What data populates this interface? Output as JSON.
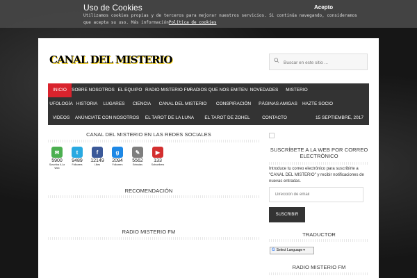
{
  "cookie_bar": {
    "title": "Uso de Cookies",
    "text": "Utilizamos cookies propias y de terceros para mejorar nuestros servicios. Si continúa navegando, consideramos que acepta su uso. Más información",
    "link": "Política de cookies",
    "accept": "Acepto"
  },
  "site": {
    "logo_text": "CANAL DEL MISTERIO",
    "search_placeholder": "Buscar en este sitio ..."
  },
  "nav": {
    "rows": [
      [
        "INICIO",
        "SOBRE NOSOTROS",
        "EL EQUIPO",
        "RADIO MISTERIO FM",
        "RADIOS QUE NOS EMITEN",
        "NOVEDADES",
        "MISTERIO"
      ],
      [
        "UFOLOGÍA",
        "HISTORIA",
        "LUGARES",
        "CIENCIA",
        "CANAL DEL MISTERIO",
        "CONSPIRACIÓN",
        "PÁGINAS AMIGAS",
        "HAZTE SOCIO"
      ],
      [
        "VIDEOS",
        "ANÚNCIATE CON NOSOTROS",
        "EL TAROT DE LA LUNA",
        "EL TAROT DE ZOHEL",
        "CONTACTO"
      ]
    ],
    "date": "15 SEPTIEMBRE, 2017"
  },
  "main": {
    "social_title": "CANAL DEL MISTERIO EN LAS REDES SOCIALES",
    "social": [
      {
        "count": "5900",
        "label": "Suscritos A La Web",
        "icon": "subscribers-icon",
        "color": "#4caf50"
      },
      {
        "count": "9489",
        "label": "Followers",
        "icon": "twitter-icon",
        "color": "#29a9e1"
      },
      {
        "count": "12149",
        "label": "Likes",
        "icon": "facebook-icon",
        "color": "#3b5998"
      },
      {
        "count": "2094",
        "label": "Followers",
        "icon": "google-plus-icon",
        "color": "#1e88e5"
      },
      {
        "count": "5562",
        "label": "Entradas",
        "icon": "posts-icon",
        "color": "#7e7e7e"
      },
      {
        "count": "133",
        "label": "Subscribers",
        "icon": "youtube-icon",
        "color": "#d32f2f"
      }
    ],
    "recommend_title": "RECOMENDACIÓN",
    "radio_title": "RADIO MISTERIO FM"
  },
  "sidebar": {
    "subscribe_title": "SUSCRÍBETE A LA WEB POR CORREO ELECTRÓNICO",
    "subscribe_text": "Introduce tu correo electrónico para suscribirte a \"CANAL DEL MISTERIO\" y recibir notificaciones de nuevas entradas.",
    "email_placeholder": "Dirección de email",
    "subscribe_button": "SUSCRIBIR",
    "translator_title": "TRADUCTOR",
    "language_select": "Select Language",
    "radio_title": "RADIO MISTERIO FM"
  }
}
